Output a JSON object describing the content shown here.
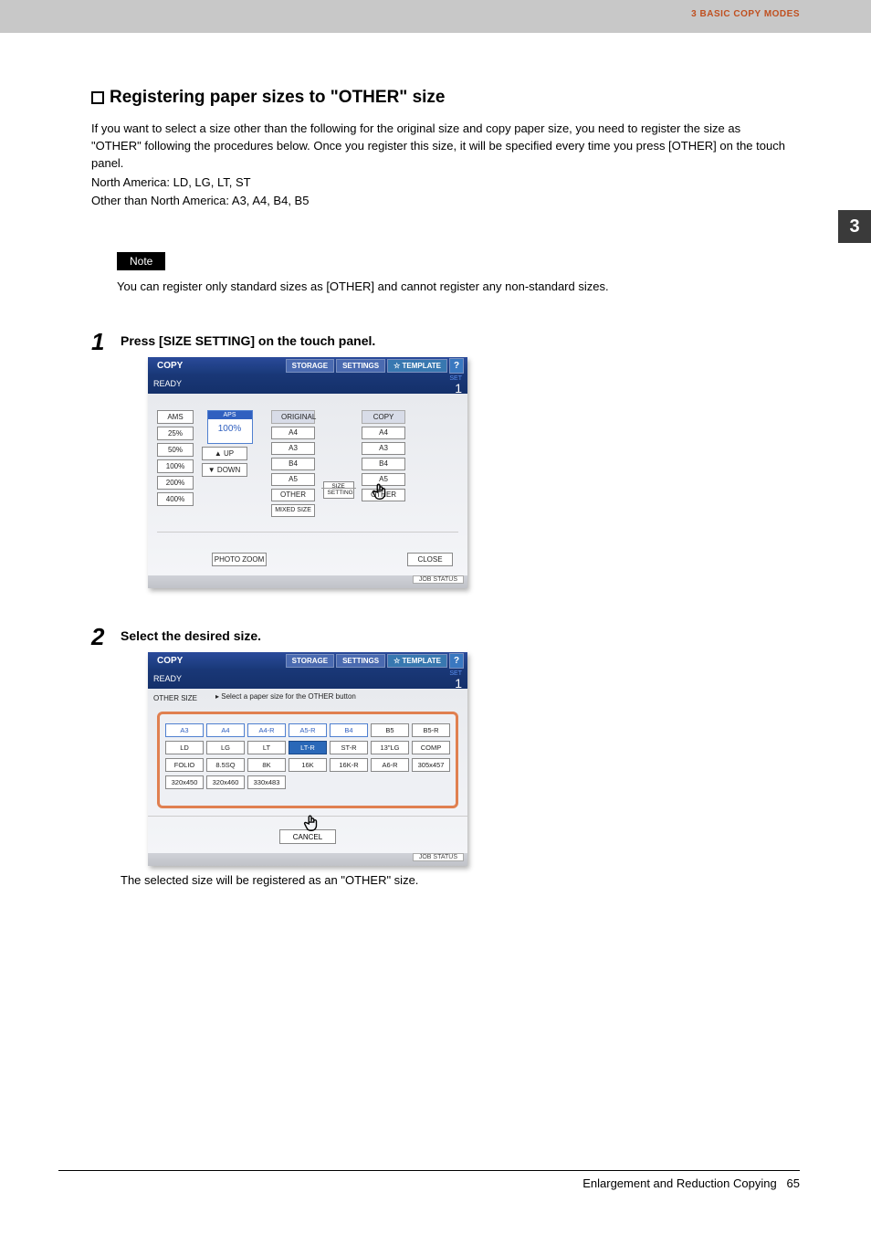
{
  "header": {
    "section": "3 BASIC COPY MODES",
    "tab": "3"
  },
  "title": "Registering paper sizes to \"OTHER\" size",
  "intro": [
    "If you want to select a size other than the following for the original size and copy paper size, you need to register the size as \"OTHER\" following the procedures below. Once you register this size, it will be specified every time you press [OTHER] on the touch panel.",
    "North America: LD, LG, LT, ST",
    "Other than North America: A3, A4, B4, B5"
  ],
  "note": {
    "label": "Note",
    "text": "You can register only standard sizes as [OTHER] and cannot register any non-standard sizes."
  },
  "steps": [
    {
      "num": "1",
      "title": "Press [SIZE SETTING] on the touch panel."
    },
    {
      "num": "2",
      "title": "Select the desired size.",
      "note": "The selected size will be registered as an \"OTHER\" size."
    }
  ],
  "panel_common": {
    "app": "COPY",
    "status": "READY",
    "storage": "STORAGE",
    "settings": "SETTINGS",
    "template": "TEMPLATE",
    "help": "?",
    "set": "SET",
    "set_count": "1",
    "job_status": "JOB STATUS"
  },
  "panel1": {
    "zoom": [
      "AMS",
      "25%",
      "50%",
      "100%",
      "200%",
      "400%"
    ],
    "aps": "APS",
    "zoom_val": "100%",
    "up": "UP",
    "down": "DOWN",
    "original": "ORIGINAL",
    "copy": "COPY",
    "sizes": [
      "A4",
      "A3",
      "B4",
      "A5",
      "OTHER"
    ],
    "mixed": "MIXED SIZE",
    "size_setting": "SIZE SETTING",
    "photo_zoom": "PHOTO ZOOM",
    "close": "CLOSE"
  },
  "panel2": {
    "screen_label": "OTHER SIZE",
    "instr": "▸ Select a paper size for the OTHER button",
    "rows": [
      [
        {
          "t": "A3",
          "c": "blue"
        },
        {
          "t": "A4",
          "c": "blue"
        },
        {
          "t": "A4-R",
          "c": "blue"
        },
        {
          "t": "A5-R",
          "c": "blue"
        },
        {
          "t": "B4",
          "c": "blue"
        },
        {
          "t": "B5",
          "c": ""
        },
        {
          "t": "B5-R",
          "c": ""
        }
      ],
      [
        {
          "t": "LD",
          "c": ""
        },
        {
          "t": "LG",
          "c": ""
        },
        {
          "t": "LT",
          "c": ""
        },
        {
          "t": "LT-R",
          "c": "sel"
        },
        {
          "t": "ST-R",
          "c": ""
        },
        {
          "t": "13\"LG",
          "c": ""
        },
        {
          "t": "COMP",
          "c": ""
        }
      ],
      [
        {
          "t": "FOLIO",
          "c": ""
        },
        {
          "t": "8.5SQ",
          "c": ""
        },
        {
          "t": "8K",
          "c": ""
        },
        {
          "t": "16K",
          "c": ""
        },
        {
          "t": "16K-R",
          "c": ""
        },
        {
          "t": "A6-R",
          "c": ""
        },
        {
          "t": "305x457",
          "c": ""
        }
      ],
      [
        {
          "t": "320x450",
          "c": ""
        },
        {
          "t": "320x460",
          "c": ""
        },
        {
          "t": "330x483",
          "c": ""
        },
        {
          "t": "",
          "c": "empty"
        },
        {
          "t": "",
          "c": "empty"
        },
        {
          "t": "",
          "c": "empty"
        },
        {
          "t": "",
          "c": "empty"
        }
      ]
    ],
    "cancel": "CANCEL"
  },
  "footer": {
    "text": "Enlargement and Reduction Copying",
    "page": "65"
  }
}
